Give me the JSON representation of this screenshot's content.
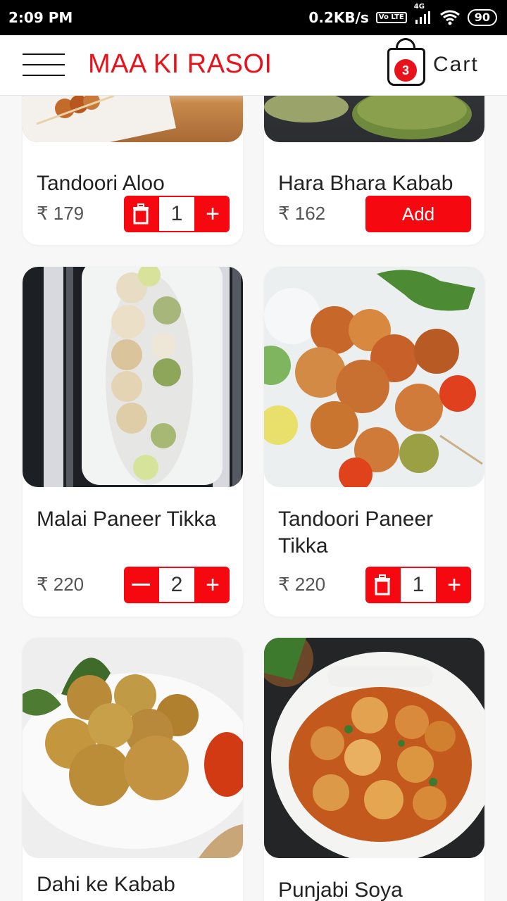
{
  "status_bar": {
    "time": "2:09 PM",
    "net_speed": "0.2KB/s",
    "volte": "Vo LTE",
    "network": "4G",
    "battery": "90"
  },
  "app_bar": {
    "title": "MAA KI RASOI",
    "cart_label": "Cart",
    "cart_count": "3"
  },
  "theme": {
    "accent": "#f5080f",
    "title_color": "#e8121a"
  },
  "items": [
    {
      "name": "Tandoori Aloo",
      "price": "₹ 179",
      "quantity": "1",
      "control": "stepper-delete"
    },
    {
      "name": "Hara Bhara Kabab",
      "price": "₹ 162",
      "add_label": "Add",
      "control": "add"
    },
    {
      "name": "Malai Paneer Tikka",
      "price": "₹ 220",
      "quantity": "2",
      "control": "stepper-minus"
    },
    {
      "name": "Tandoori Paneer Tikka",
      "price": "₹ 220",
      "quantity": "1",
      "control": "stepper-delete"
    },
    {
      "name": "Dahi ke Kabab",
      "control": "none"
    },
    {
      "name": "Punjabi Soya",
      "control": "none"
    }
  ]
}
